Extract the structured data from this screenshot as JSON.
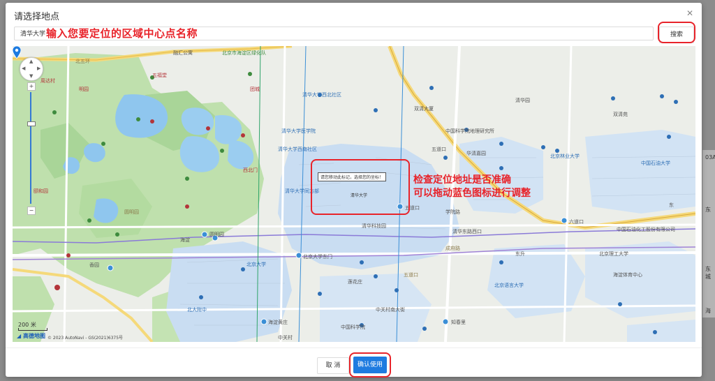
{
  "dialog": {
    "title": "请选择地点",
    "close_icon": "close-icon"
  },
  "search": {
    "value": "清华大学",
    "button_label": "搜索"
  },
  "annotations": {
    "input_hint": "输入您要定位的区域中心点名称",
    "map_hint_line1": "检查定位地址是否准确",
    "map_hint_line2": "可以拖动蓝色图标进行调整"
  },
  "map": {
    "tooltip": "请您移动此标记，选择您的坐标！",
    "marker_label": "清华大学",
    "scale_label": "200 米",
    "logo": "高德地图",
    "copyright": "© 2023 AutoNavi - GS(2021)6375号",
    "zoom_in": "+",
    "zoom_out": "−",
    "place_labels": {
      "rongyu": "融汇公寓",
      "haidian_center": "北京市海淀区绿化队",
      "wufu": "五福堂",
      "zhouyangcun": "周达村",
      "beifusi": "北五环",
      "mingyuan": "明园",
      "tuanchengguan": "团城",
      "shuangqingyuan": "双清苑",
      "shuangyuan": "西北门",
      "dongdian": "东",
      "xiangyuan": "香园",
      "tsinghua_northwest": "清华大学西北社区",
      "tsinghua_gym": "清华大学医学院",
      "tsinghua_east": "清华大学西南社区",
      "tsinghua_west": "清华大学同方部",
      "beida": "北京大学",
      "wudaokou": "五道口",
      "zhongguancun": "中关村",
      "chengfu": "成府路",
      "lianhua": "莲花庄",
      "yuanmingyuan": "圆明园",
      "yiheyuan": "颐和园",
      "haidian": "海淀",
      "beijing_linye": "北京林业大学",
      "yuyuan": "语言大学",
      "qinghuayuan": "清华园",
      "shuangqing": "双清大厦",
      "zhongguo_yiliao": "中国科学院地理研究所",
      "dongsheng": "东升",
      "keji_bldg": "清华科技园",
      "zhongguo_kexue": "中国科学院",
      "huaqing": "华清嘉园",
      "xueyuan": "学院路",
      "hsinhua": "北京语言大学",
      "shiyou": "中国石油大学",
      "shiyou_bldg": "中国石油化工股份有限公司",
      "renmin": "北京理工大学",
      "hepingli": "海淀体育中心",
      "beida_fuzhong": "北大附中",
      "zhongguancun_x": "中关村南大街",
      "gaode": "五道口"
    },
    "metro_labels": {
      "m1": "五道口",
      "m2": "圆明园",
      "m3": "北京大学东门",
      "m4": "清华东路西口",
      "m5": "六道口",
      "m6": "知春里",
      "m7": "海淀黄庄"
    }
  },
  "footer": {
    "cancel_label": "取 消",
    "confirm_label": "确认使用"
  },
  "background": {
    "edge_labels": [
      "03A",
      "东",
      "东城",
      "海"
    ]
  },
  "colors": {
    "accent_blue": "#1e7be0",
    "annotation_red": "#e8232a",
    "campus_blue": "#c9ddf2",
    "park_green": "#b9dfa6",
    "water": "#8fc6ee"
  }
}
